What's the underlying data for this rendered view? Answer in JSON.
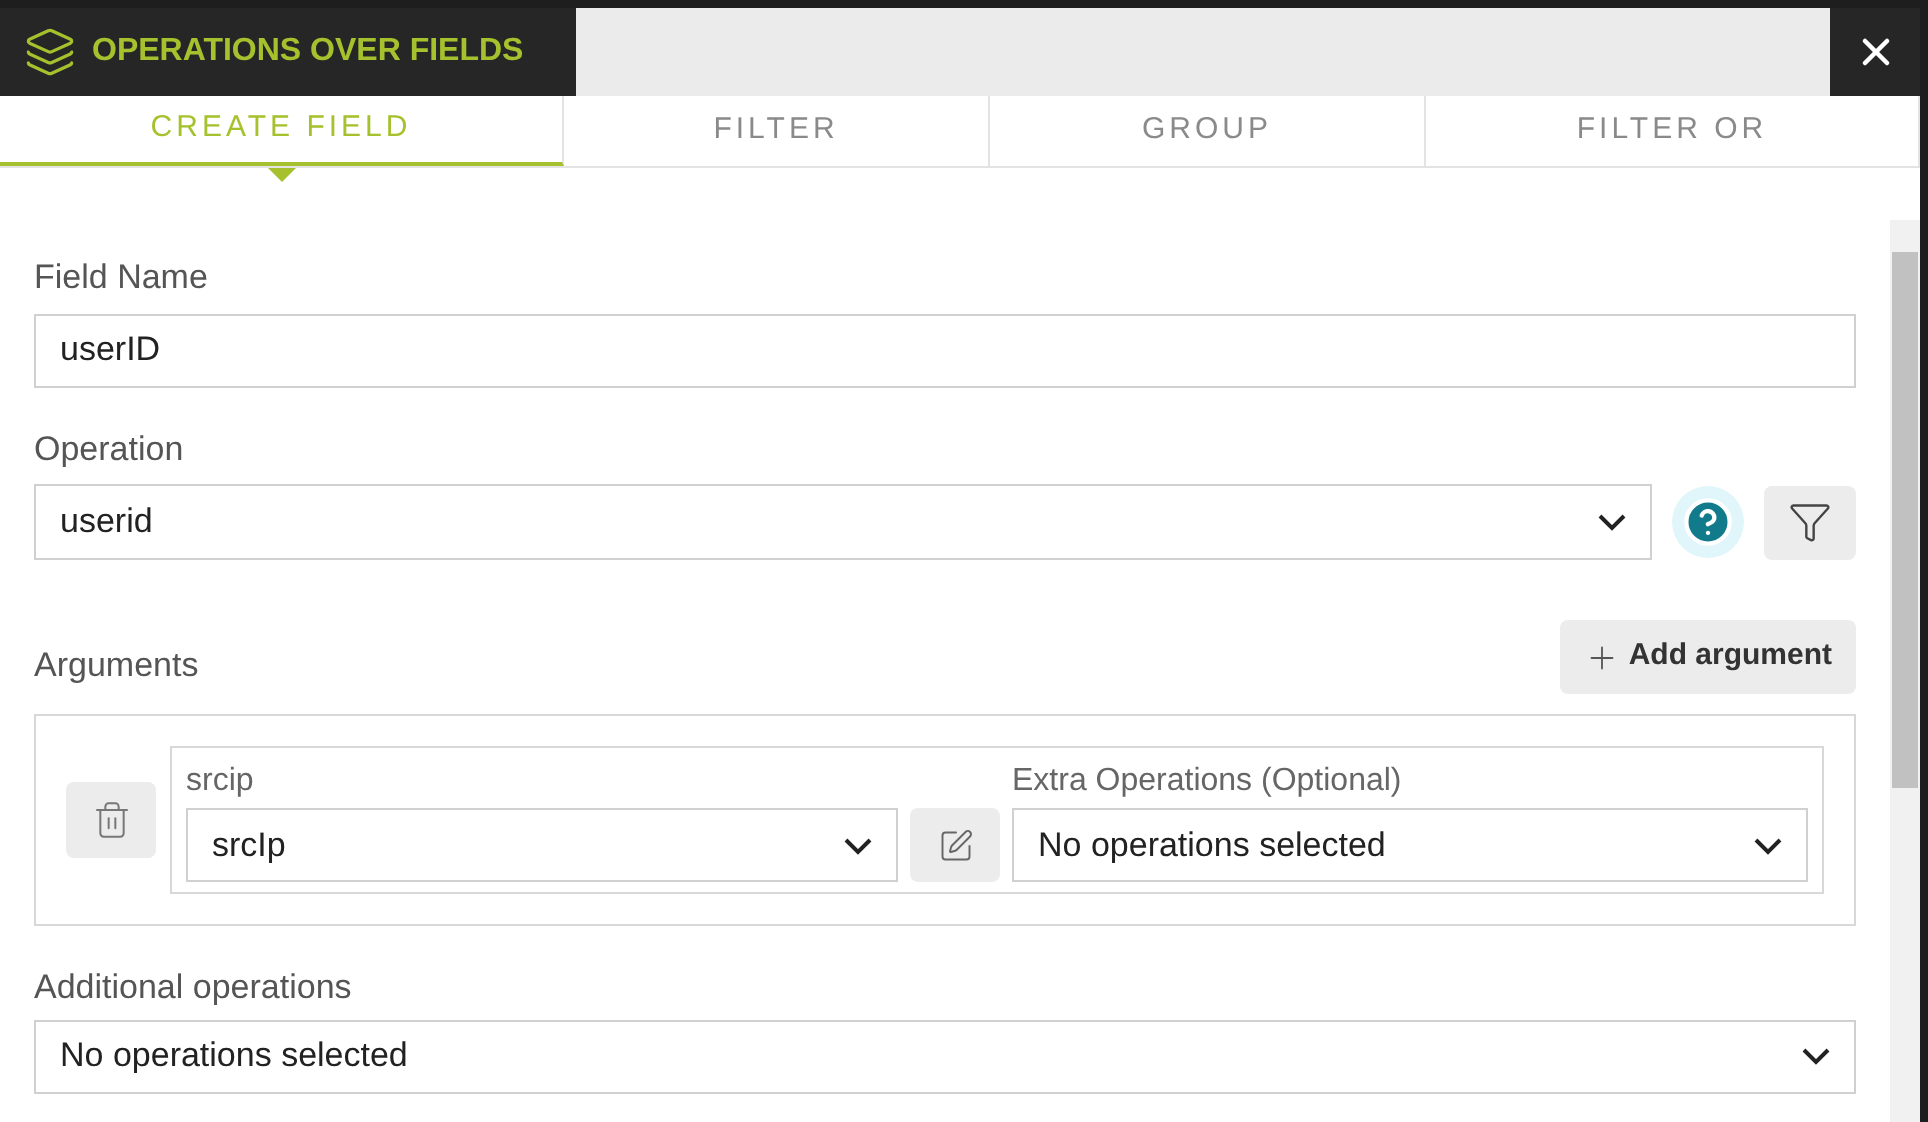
{
  "window": {
    "title": "OPERATIONS OVER FIELDS"
  },
  "tabs": [
    {
      "label": "CREATE FIELD",
      "selected": true
    },
    {
      "label": "FILTER",
      "selected": false
    },
    {
      "label": "GROUP",
      "selected": false
    },
    {
      "label": "FILTER OR",
      "selected": false
    }
  ],
  "field_name": {
    "label": "Field Name",
    "value": "userID"
  },
  "operation": {
    "label": "Operation",
    "value": "userid"
  },
  "arguments": {
    "label": "Arguments",
    "add_button": "Add argument",
    "items": [
      {
        "name": "srcip",
        "value": "srcIp",
        "extra_label": "Extra Operations (Optional)",
        "extra_value": "No operations selected"
      }
    ]
  },
  "additional_operations": {
    "label": "Additional operations",
    "value": "No operations selected"
  }
}
